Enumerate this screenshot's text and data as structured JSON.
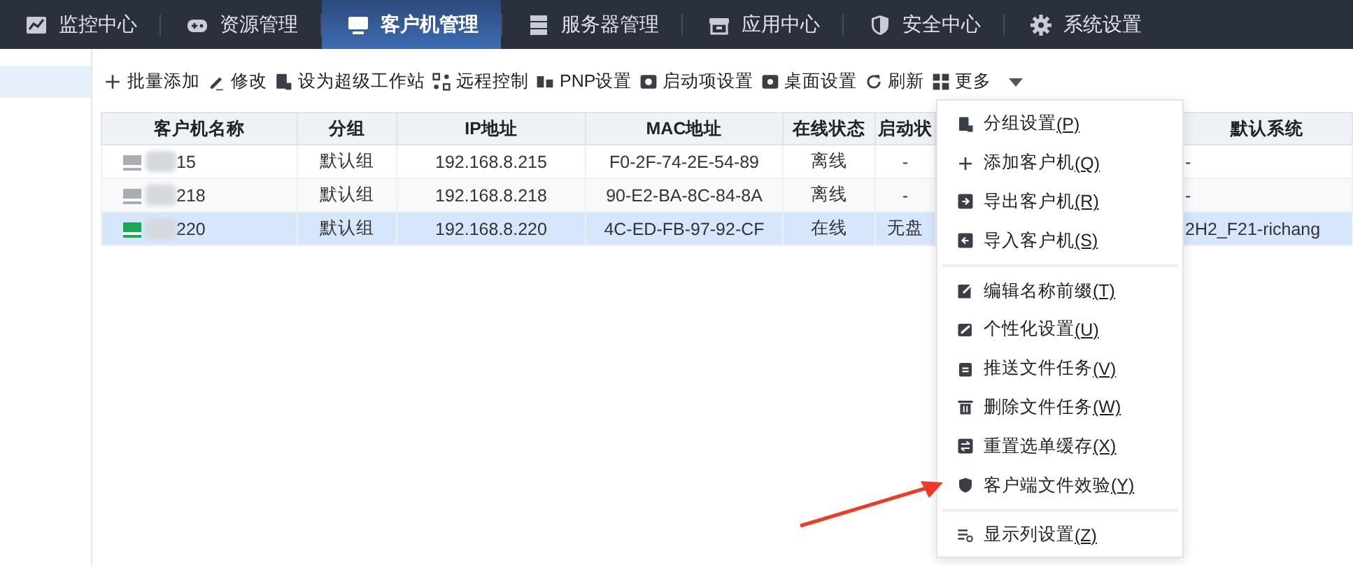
{
  "nav_tabs": [
    {
      "label": "监控中心",
      "selected": false
    },
    {
      "label": "资源管理",
      "selected": false
    },
    {
      "label": "客户机管理",
      "selected": true
    },
    {
      "label": "服务器管理",
      "selected": false
    },
    {
      "label": "应用中心",
      "selected": false
    },
    {
      "label": "安全中心",
      "selected": false
    },
    {
      "label": "系统设置",
      "selected": false
    }
  ],
  "sidebar": {
    "items": [
      {
        "selected": true
      }
    ]
  },
  "toolbar": [
    {
      "label": "批量添加"
    },
    {
      "label": "修改"
    },
    {
      "label": "设为超级工作站"
    },
    {
      "label": "远程控制"
    },
    {
      "label": "PNP设置"
    },
    {
      "label": "启动项设置"
    },
    {
      "label": "桌面设置"
    },
    {
      "label": "刷新"
    },
    {
      "label": "更多",
      "dropdown": true
    }
  ],
  "table": {
    "columns": [
      "客户机名称",
      "分组",
      "IP地址",
      "MAC地址",
      "在线状态",
      "启动状",
      "",
      "默认系统"
    ],
    "rows": [
      {
        "selected": false,
        "online": false,
        "cells": [
          "15",
          "默认组",
          "192.168.8.215",
          "F0-2F-74-2E-54-89",
          "离线",
          "-",
          "",
          "-"
        ]
      },
      {
        "selected": false,
        "online": false,
        "cells": [
          "218",
          "默认组",
          "192.168.8.218",
          "90-E2-BA-8C-84-8A",
          "离线",
          "-",
          "",
          "-"
        ]
      },
      {
        "selected": true,
        "online": true,
        "cells": [
          "220",
          "默认组",
          "192.168.8.220",
          "4C-ED-FB-97-92-CF",
          "在线",
          "无盘",
          "",
          "2H2_F21-richang"
        ]
      }
    ]
  },
  "more_menu": [
    {
      "kind": "item",
      "label": "分组设置",
      "accel": "(P)"
    },
    {
      "kind": "item",
      "label": "添加客户机",
      "accel": "(Q)"
    },
    {
      "kind": "item",
      "label": "导出客户机",
      "accel": "(R)"
    },
    {
      "kind": "item",
      "label": "导入客户机",
      "accel": "(S)"
    },
    {
      "kind": "separator"
    },
    {
      "kind": "item",
      "label": "编辑名称前缀",
      "accel": "(T)"
    },
    {
      "kind": "item",
      "label": "个性化设置",
      "accel": "(U)"
    },
    {
      "kind": "item",
      "label": "推送文件任务",
      "accel": "(V)"
    },
    {
      "kind": "item",
      "label": "删除文件任务",
      "accel": "(W)"
    },
    {
      "kind": "item",
      "label": "重置选单缓存",
      "accel": "(X)"
    },
    {
      "kind": "item",
      "label": "客户端文件效验",
      "accel": "(Y)"
    },
    {
      "kind": "separator"
    },
    {
      "kind": "item",
      "label": "显示列设置",
      "accel": "(Z)"
    }
  ]
}
